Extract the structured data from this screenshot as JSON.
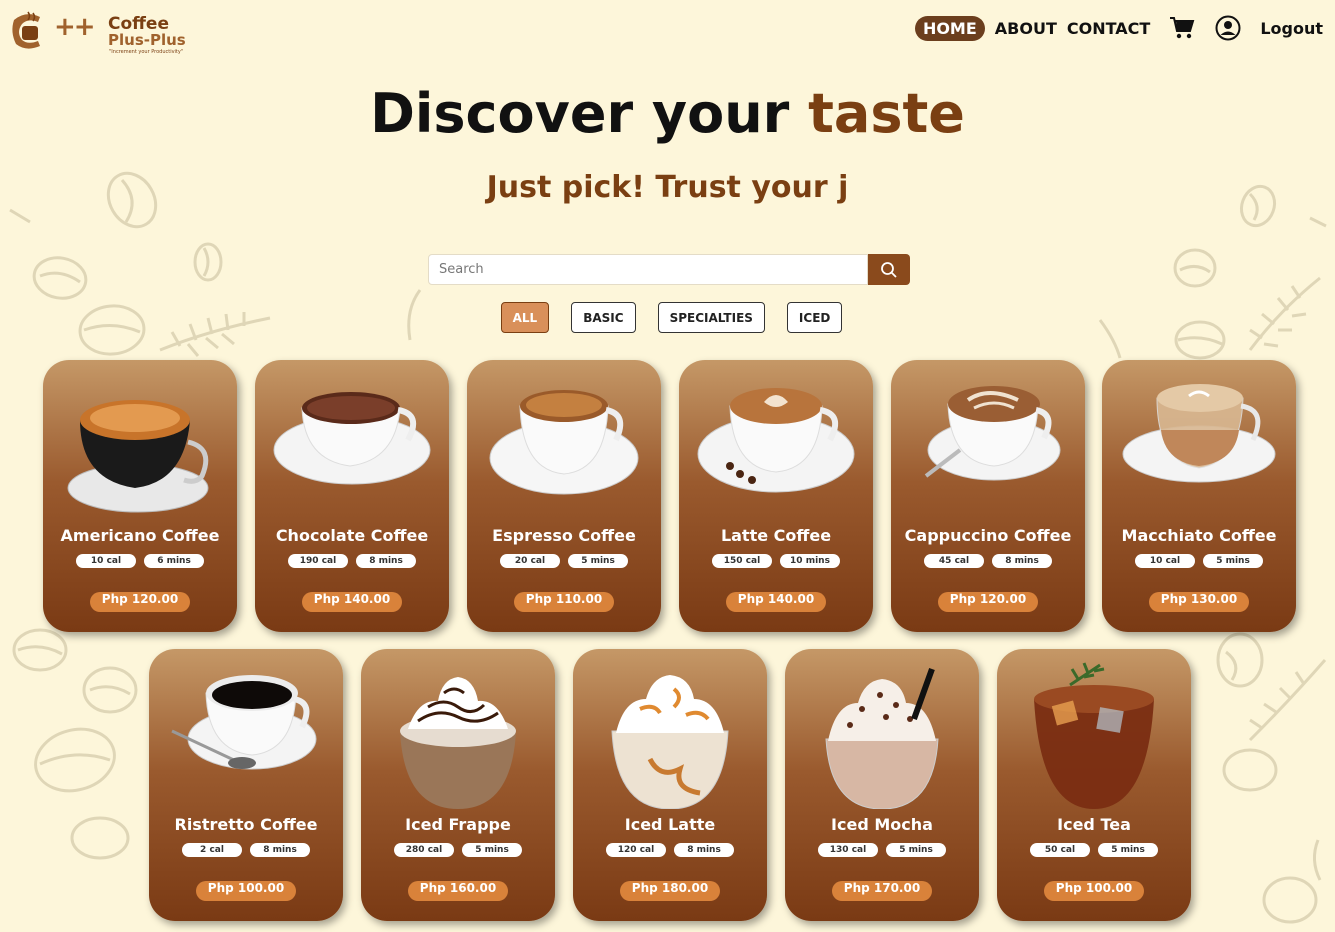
{
  "brand": {
    "name_line1": "Coffee",
    "name_line2": "Plus-Plus",
    "symbol": "C++",
    "tagline": "\"Increment your Productivity\""
  },
  "nav": {
    "home": "HOME",
    "about": "ABOUT",
    "contact": "CONTACT",
    "cart_icon": "cart-icon",
    "account_icon": "user-circle-icon",
    "logout": "Logout"
  },
  "hero": {
    "title_main": "Discover your ",
    "title_accent": "taste",
    "subtitle": "Just pick! Trust your j"
  },
  "search": {
    "placeholder": "Search",
    "value": "",
    "icon": "search-icon"
  },
  "filters": {
    "all": "ALL",
    "basic": "BASIC",
    "specialties": "SPECIALTIES",
    "iced": "ICED",
    "active": "ALL"
  },
  "products": [
    {
      "name": "Americano Coffee",
      "cal": "10 cal",
      "time": "6 mins",
      "price": "Php 120.00"
    },
    {
      "name": "Chocolate Coffee",
      "cal": "190 cal",
      "time": "8 mins",
      "price": "Php 140.00"
    },
    {
      "name": "Espresso Coffee",
      "cal": "20 cal",
      "time": "5 mins",
      "price": "Php 110.00"
    },
    {
      "name": "Latte Coffee",
      "cal": "150 cal",
      "time": "10 mins",
      "price": "Php 140.00"
    },
    {
      "name": "Cappuccino Coffee",
      "cal": "45 cal",
      "time": "8 mins",
      "price": "Php 120.00"
    },
    {
      "name": "Macchiato Coffee",
      "cal": "10 cal",
      "time": "5 mins",
      "price": "Php 130.00"
    },
    {
      "name": "Ristretto Coffee",
      "cal": "2 cal",
      "time": "8 mins",
      "price": "Php 100.00"
    },
    {
      "name": "Iced Frappe",
      "cal": "280 cal",
      "time": "5 mins",
      "price": "Php 160.00"
    },
    {
      "name": "Iced Latte",
      "cal": "120 cal",
      "time": "8 mins",
      "price": "Php 180.00"
    },
    {
      "name": "Iced Mocha",
      "cal": "130 cal",
      "time": "5 mins",
      "price": "Php 170.00"
    },
    {
      "name": "Iced Tea",
      "cal": "50 cal",
      "time": "5 mins",
      "price": "Php 100.00"
    }
  ],
  "colors": {
    "background": "#fdf6da",
    "brand_brown": "#7a3f12",
    "nav_active": "#6b3e1d",
    "price_pill": "#d9823a",
    "filter_active": "#d9905a"
  }
}
